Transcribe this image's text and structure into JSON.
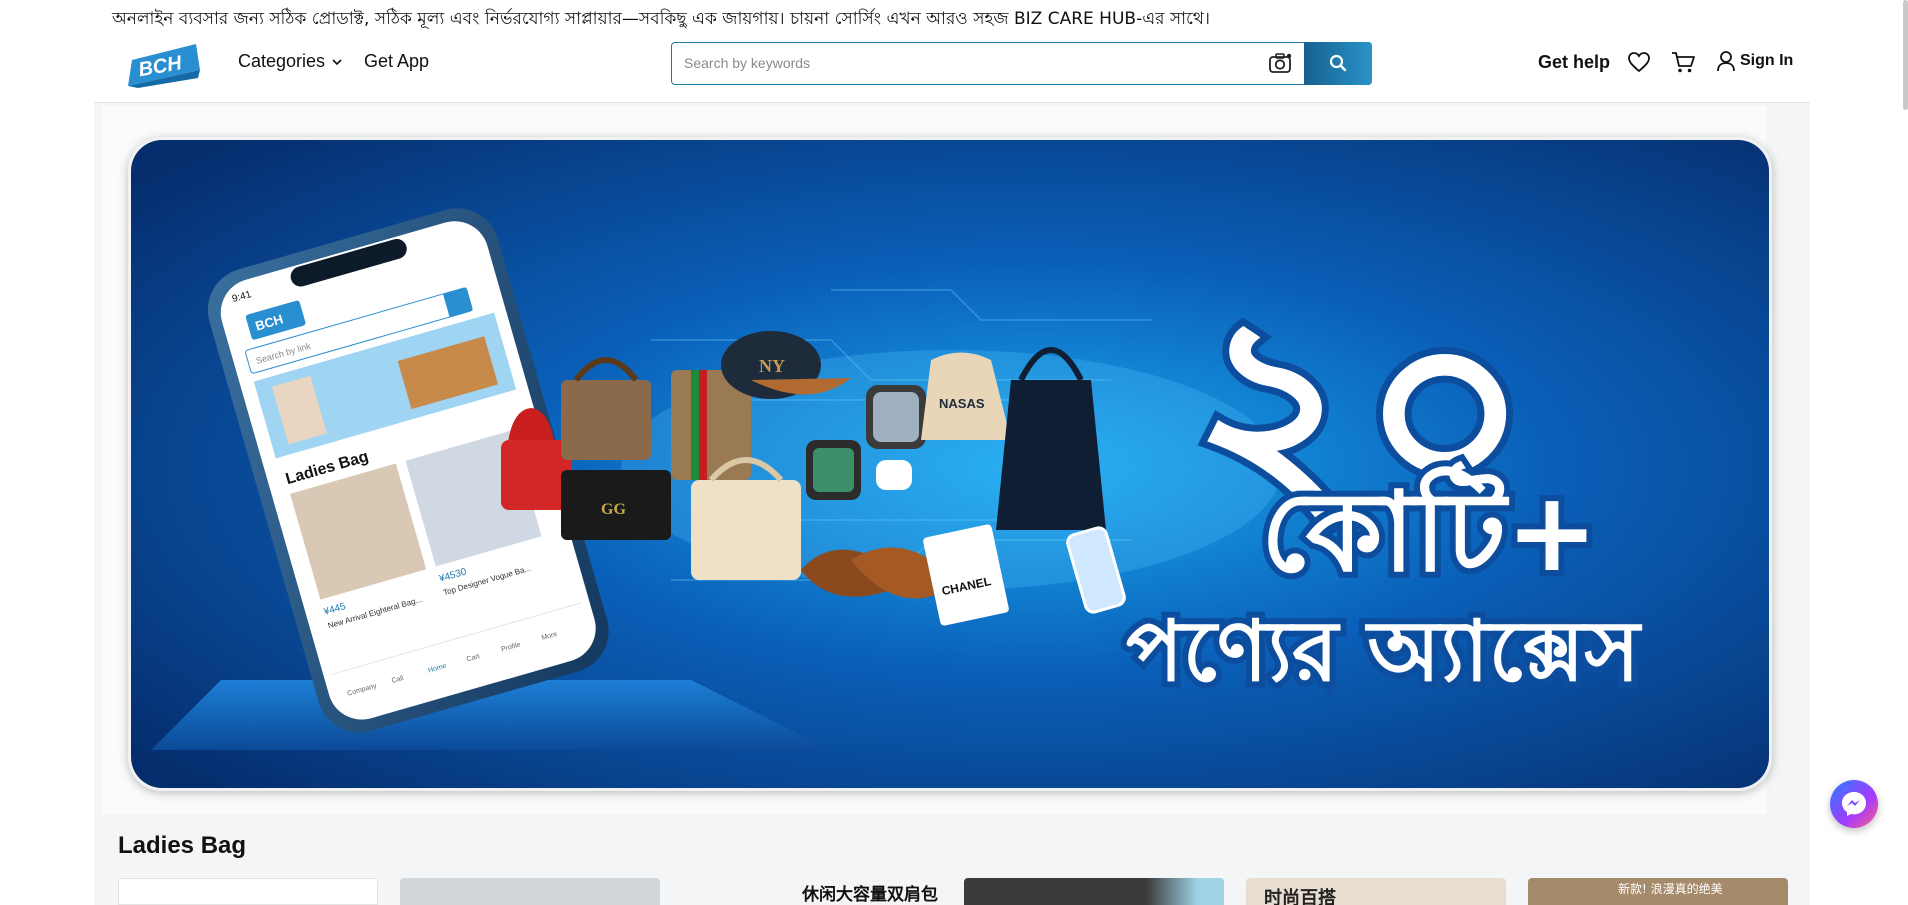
{
  "announcement": "অনলাইন ব্যবসার জন্য সঠিক প্রোডাক্ট, সঠিক মূল্য এবং নির্ভরযোগ্য সাপ্লায়ার—সবকিছু এক জায়গায়। চায়না সোর্সিং এখন আরও সহজ BIZ CARE HUB-এর সাথে।",
  "logo_text": "BCH",
  "nav": {
    "categories_label": "Categories",
    "get_app_label": "Get App",
    "get_help_label": "Get help",
    "sign_in_label": "Sign In"
  },
  "search": {
    "placeholder": "Search by keywords"
  },
  "banner": {
    "number_text": "২০",
    "crore_text": "কোটি+",
    "access_text": "পণ্যের অ্যাক্সেস",
    "phone": {
      "time": "9:41",
      "logo": "BCH",
      "search_placeholder": "Search by link",
      "section_label": "Ladies Bag",
      "item1_price": "¥445",
      "item1_title": "New Arrival Eighteral Bag...",
      "item2_price": "¥4530",
      "item2_title": "Top Designer Vogue Ba...",
      "nav_company": "Company",
      "nav_call": "Call",
      "nav_home": "Home",
      "nav_cart": "Cart",
      "nav_profile": "Profile",
      "nav_more": "More"
    },
    "product_labels": {
      "hoodie_text": "NASAS",
      "bag_text": "CHANEL"
    }
  },
  "section": {
    "title": "Ladies Bag",
    "card_texts": [
      "",
      "",
      "休闲大容量双肩包",
      "",
      "时尚百搭",
      "新款! 浪漫真的绝美"
    ]
  },
  "colors": {
    "brand_blue": "#1b79a8",
    "banner_dark": "#062e6e",
    "banner_light": "#0a8fd8"
  }
}
